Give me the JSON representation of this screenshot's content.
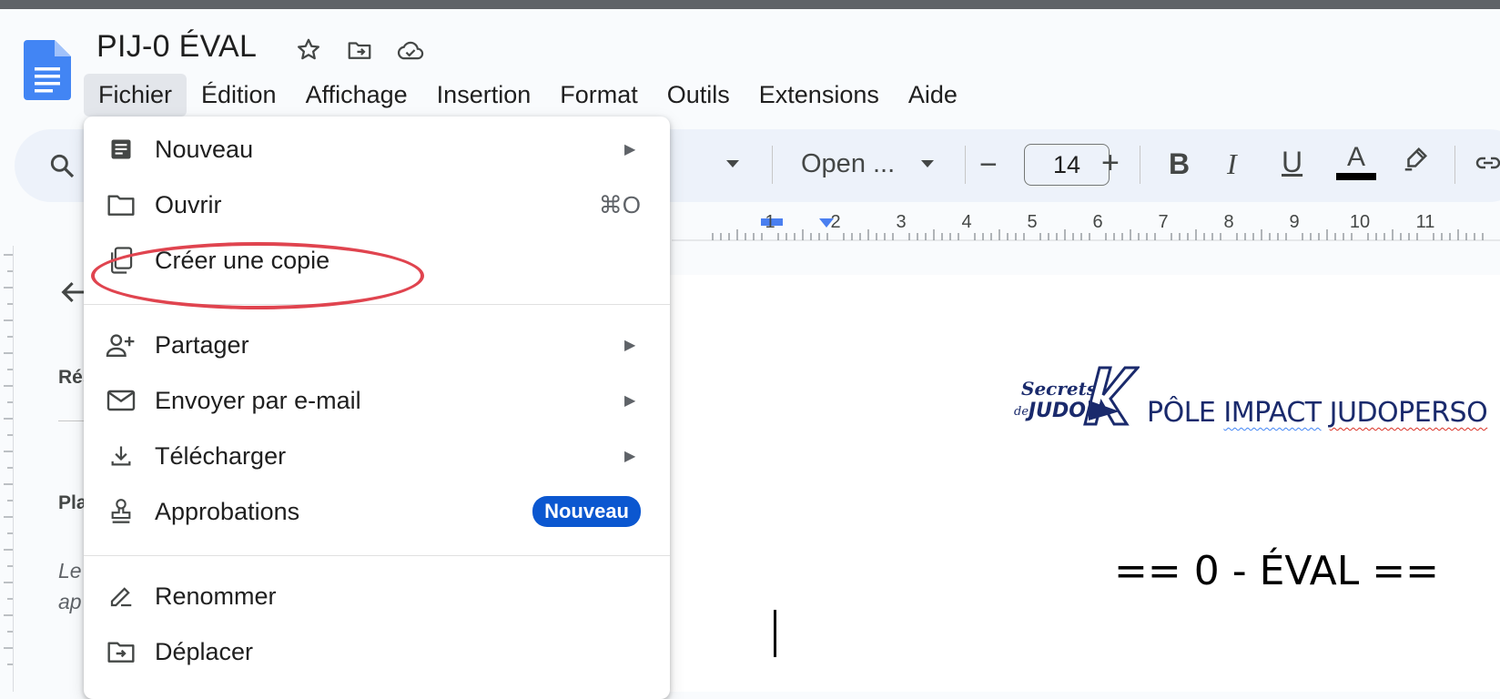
{
  "document": {
    "title": "PIJ-0 ÉVAL",
    "header_text_a": "PÔLE ",
    "header_text_b": "IMPACT",
    "header_text_c": " ",
    "header_text_d": "JUDOPERSO",
    "heading": "== 0 - ÉVAL =="
  },
  "logo": {
    "line1": "Secrets",
    "line2": "de",
    "line3": "JUDO",
    "mark": "K"
  },
  "menubar": {
    "items": [
      "Fichier",
      "Édition",
      "Affichage",
      "Insertion",
      "Format",
      "Outils",
      "Extensions",
      "Aide"
    ],
    "active": "Fichier"
  },
  "toolbar": {
    "font": "Open ...",
    "font_size": "14",
    "minus": "−",
    "plus": "+",
    "bold": "B",
    "italic": "I",
    "underline": "U",
    "text_color": "A"
  },
  "ruler": {
    "labels": [
      "1",
      "2",
      "3",
      "4",
      "5",
      "6",
      "7",
      "8",
      "9",
      "10",
      "11"
    ]
  },
  "outline": {
    "res": "Rés",
    "pla": "Pla",
    "le_line1": "Le",
    "le_line2": "ap"
  },
  "file_menu": {
    "items": [
      {
        "label": "Nouveau",
        "icon": "doc-icon",
        "submenu": true
      },
      {
        "label": "Ouvrir",
        "icon": "folder-icon",
        "shortcut": "⌘O"
      },
      {
        "label": "Créer une copie",
        "icon": "copy-icon"
      },
      {
        "label": "Partager",
        "icon": "person-add-icon",
        "submenu": true
      },
      {
        "label": "Envoyer par e-mail",
        "icon": "mail-icon",
        "submenu": true
      },
      {
        "label": "Télécharger",
        "icon": "download-icon",
        "submenu": true
      },
      {
        "label": "Approbations",
        "icon": "stamp-icon",
        "badge": "Nouveau"
      },
      {
        "label": "Renommer",
        "icon": "rename-icon"
      },
      {
        "label": "Déplacer",
        "icon": "move-icon"
      }
    ]
  },
  "colors": {
    "accent": "#0b57d0",
    "annotation": "#e0444f",
    "toolbar_bg": "#edf2fa",
    "doc_blue": "#1a2a6c"
  }
}
